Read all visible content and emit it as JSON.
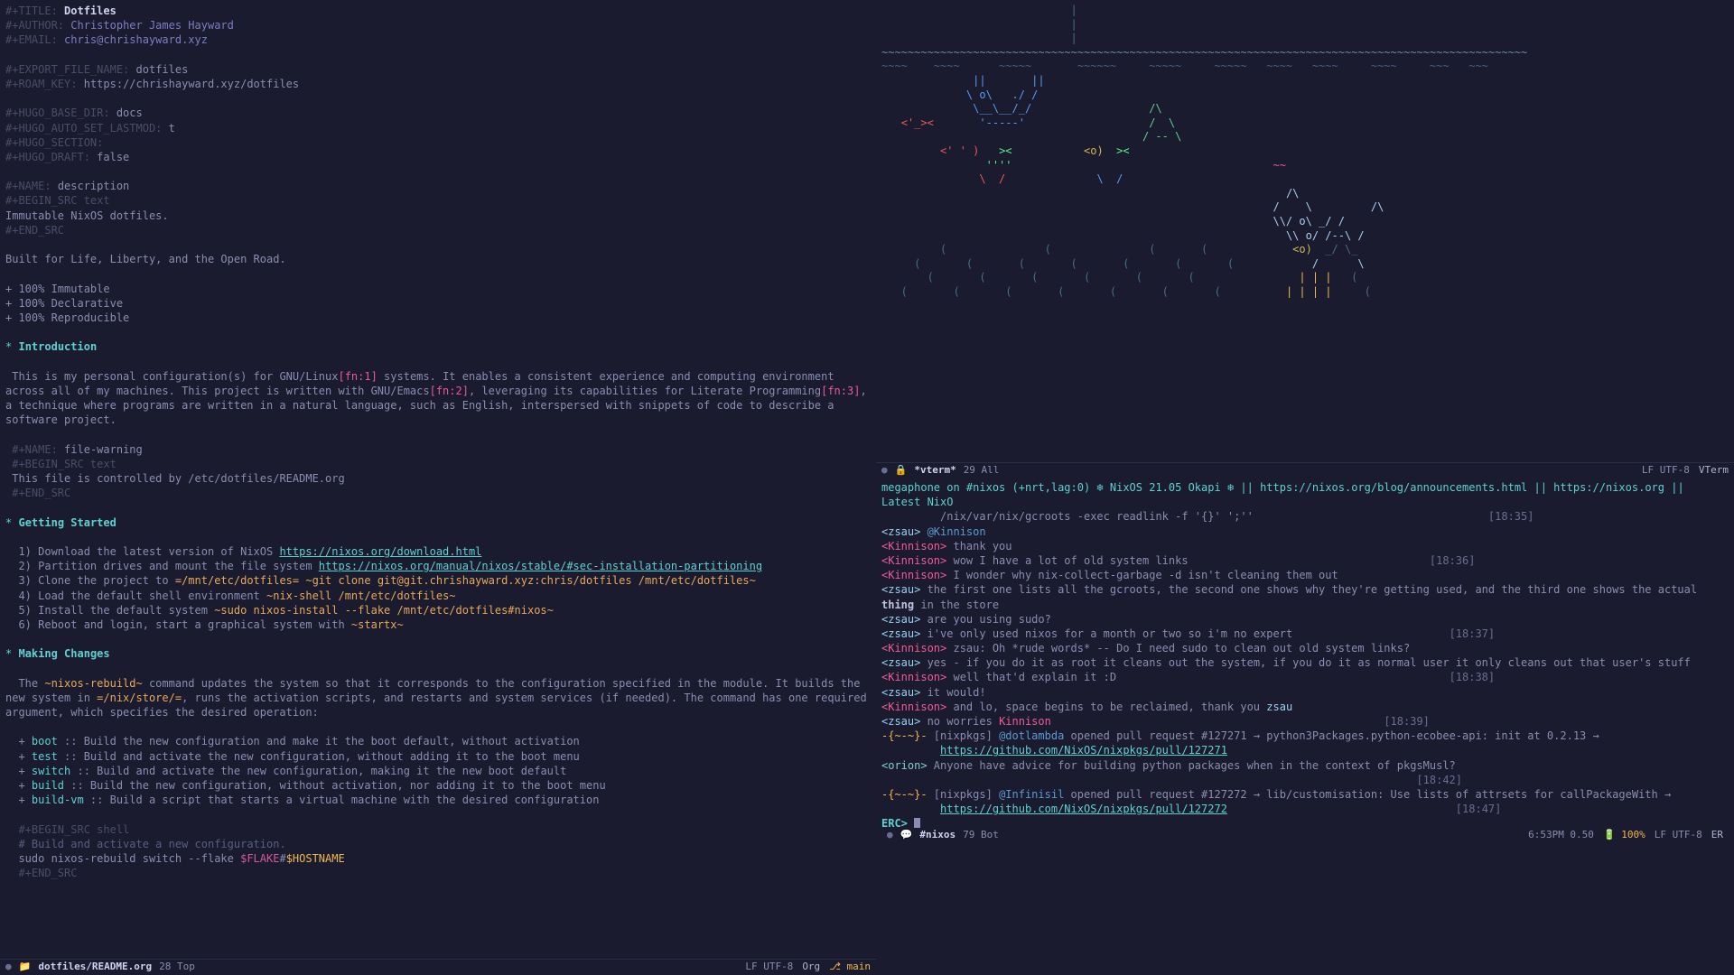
{
  "doc": {
    "h_title_key": "#+TITLE:",
    "h_title": "Dotfiles",
    "h_author_key": "#+AUTHOR:",
    "h_author": "Christopher James Hayward",
    "h_email_key": "#+EMAIL:",
    "h_email": "chris@chrishayward.xyz",
    "h_export_key": "#+EXPORT_FILE_NAME:",
    "h_export": "dotfiles",
    "h_roam_key": "#+ROAM_KEY:",
    "h_roam": "https://chrishayward.xyz/dotfiles",
    "hugo_base_key": "#+HUGO_BASE_DIR:",
    "hugo_base": "docs",
    "hugo_lastmod_key": "#+HUGO_AUTO_SET_LASTMOD:",
    "hugo_lastmod": "t",
    "hugo_section_key": "#+HUGO_SECTION:",
    "hugo_section": "",
    "hugo_draft_key": "#+HUGO_DRAFT:",
    "hugo_draft": "false",
    "name_desc_key": "#+NAME:",
    "name_desc": "description",
    "begin_src_text": "#+BEGIN_SRC text",
    "desc_body": "Immutable NixOS dotfiles.",
    "end_src": "#+END_SRC",
    "tagline": "Built for Life, Liberty, and the Open Road.",
    "b1": "+ 100% Immutable",
    "b2": "+ 100% Declarative",
    "b3": "+ 100% Reproducible",
    "h_intro": "Introduction",
    "intro_1a": " This is my personal configuration(s) for GNU/Linux",
    "fn1": "[fn:1]",
    "intro_1b": " systems. It enables a consistent experience and computing environment across all of my machines. This project is written with GNU/Emacs",
    "fn2": "[fn:2]",
    "intro_1c": ", leveraging its capabilities for Literate Programming",
    "fn3": "[fn:3]",
    "intro_1d": ", a technique where programs are written in a natural language, such as English, interspersed with snippets of code to describe a software project.",
    "name_fw_key": "#+NAME:",
    "name_fw": "file-warning",
    "fw_body": "This file is controlled by /etc/dotfiles/README.org",
    "h_getstart": "Getting Started",
    "gs1a": "  1) Download the latest version of NixOS ",
    "gs1l": "https://nixos.org/download.html",
    "gs2a": "  2) Partition drives and mount the file system ",
    "gs2l": "https://nixos.org/manual/nixos/stable/#sec-installation-partitioning",
    "gs3a": "  3) Clone the project to ",
    "gs3c1": "=/mnt/etc/dotfiles= ",
    "gs3c2": "~git clone git@git.chrishayward.xyz:chris/dotfiles /mnt/etc/dotfiles~",
    "gs4a": "  4) Load the default shell environment ",
    "gs4c": "~nix-shell /mnt/etc/dotfiles~",
    "gs5a": "  5) Install the default system ",
    "gs5c": "~sudo nixos-install --flake /mnt/etc/dotfiles#nixos~",
    "gs6a": "  6) Reboot and login, start a graphical system with ",
    "gs6c": "~startx~",
    "h_changes": "Making Changes",
    "mc_p1a": "  The ",
    "mc_p1c": "~nixos-rebuild~",
    "mc_p1b": " command updates the system so that it corresponds to the configuration specified in the module. It builds the new system in ",
    "mc_p1c2": "=/nix/store/=",
    "mc_p1d": ", runs the activation scripts, and restarts and system services (if needed). The command has one required argument, which specifies the desired operation:",
    "mc_b1k": "boot",
    "mc_b1t": " :: Build the new configuration and make it the boot default, without activation",
    "mc_b2k": "test",
    "mc_b2t": " :: Build and activate the new configuration, without adding it to the boot menu",
    "mc_b3k": "switch",
    "mc_b3t": " :: Build and activate the new configuration, making it the new boot default",
    "mc_b4k": "build",
    "mc_b4t": " :: Build the new configuration, without activation, nor adding it to the boot menu",
    "mc_b5k": "build-vm",
    "mc_b5t": " :: Build a script that starts a virtual machine with the desired configuration",
    "begin_src_shell": "#+BEGIN_SRC shell",
    "sh_comment": "# Build and activate a new configuration.",
    "sh_cmd": "sudo nixos-rebuild switch --flake ",
    "sh_env": "$FLAKE",
    "sh_sep": "#",
    "sh_host": "$HOSTNAME"
  },
  "ml_left": {
    "name": "dotfiles/README.org",
    "pos": "28 Top",
    "enc": "LF UTF-8",
    "mode": "Org",
    "branch": "main"
  },
  "ml_vterm": {
    "name": "*vterm*",
    "pos": "29 All",
    "enc": "LF UTF-8",
    "mode": "VTerm"
  },
  "irc": {
    "topic_a": "megaphone on #nixos (+nrt,lag:0) ",
    "topic_b": " NixOS 21.05 Okapi ",
    "topic_c": " || https://nixos.org/blog/announcements.html || https://nixos.org || Latest NixO",
    "topic_cmd": "/nix/var/nix/gcroots -exec readlink -f '{}' ';''",
    "t1": "[18:35]",
    "t2": "[18:36]",
    "t3": "[18:37]",
    "t4": "[18:38]",
    "t5": "[18:39]",
    "t6": "[18:42]",
    "t7": "[18:47]",
    "l1n": "<zsau>",
    "l1t": " @Kinnison",
    "l2n": "<Kinnison>",
    "l2t": " thank you",
    "l3n": "<Kinnison>",
    "l3t": " wow I have a lot of old system links",
    "l4n": "<Kinnison>",
    "l4t": " I wonder why nix-collect-garbage -d isn't cleaning them out",
    "l5n": "<zsau>",
    "l5ta": " the first one lists all the gcroots, the second one shows why they're getting used, and the third one shows the actual ",
    "l5tb": "thing",
    "l5tc": " in the store",
    "l6n": "<zsau>",
    "l6t": " are you using sudo?",
    "l7n": "<zsau>",
    "l7t": " i've only used nixos for a month or two so i'm no expert",
    "l8n": "<Kinnison>",
    "l8ta": " zsau: Oh *rude words* -- Do I need sudo to clean out old system links?",
    "l9n": "<zsau>",
    "l9t": " yes - if you do it as root it cleans out the system, if you do it as normal user it only cleans out that user's stuff",
    "l10n": "<Kinnison>",
    "l10t": " well that'd explain it :D",
    "l11n": "<zsau>",
    "l11t": " it would!",
    "l12n": "<Kinnison>",
    "l12ta": " and lo, space begins to be reclaimed, thank you ",
    "l12tb": "zsau",
    "l13n": "<zsau>",
    "l13ta": " no worries ",
    "l13tb": "Kinnison",
    "l14n": "-{~-~}-",
    "l14ta": " [nixpkgs] ",
    "l14tb": "@dotlambda",
    "l14tc": " opened pull request #127271 → python3Packages.python-ecobee-api: init at 0.2.13 → ",
    "l14u": "https://github.com/NixOS/nixpkgs/pull/127271",
    "l15n": "<orion>",
    "l15t": " Anyone have advice for building python packages when in the context of pkgsMusl?",
    "l16n": "-{~-~}-",
    "l16ta": " [nixpkgs] ",
    "l16tb": "@Infinisil",
    "l16tc": " opened pull request #127272 → lib/customisation: Use lists of attrsets for callPackageWith → ",
    "l16u": "https://github.com/NixOS/nixpkgs/pull/127272",
    "prompt": "ERC>"
  },
  "ml_irc": {
    "name": "#nixos",
    "pos": "79 Bot",
    "clock": "6:53PM 0.50",
    "bat": "100%",
    "enc": "LF UTF-8",
    "mode": "ER"
  }
}
